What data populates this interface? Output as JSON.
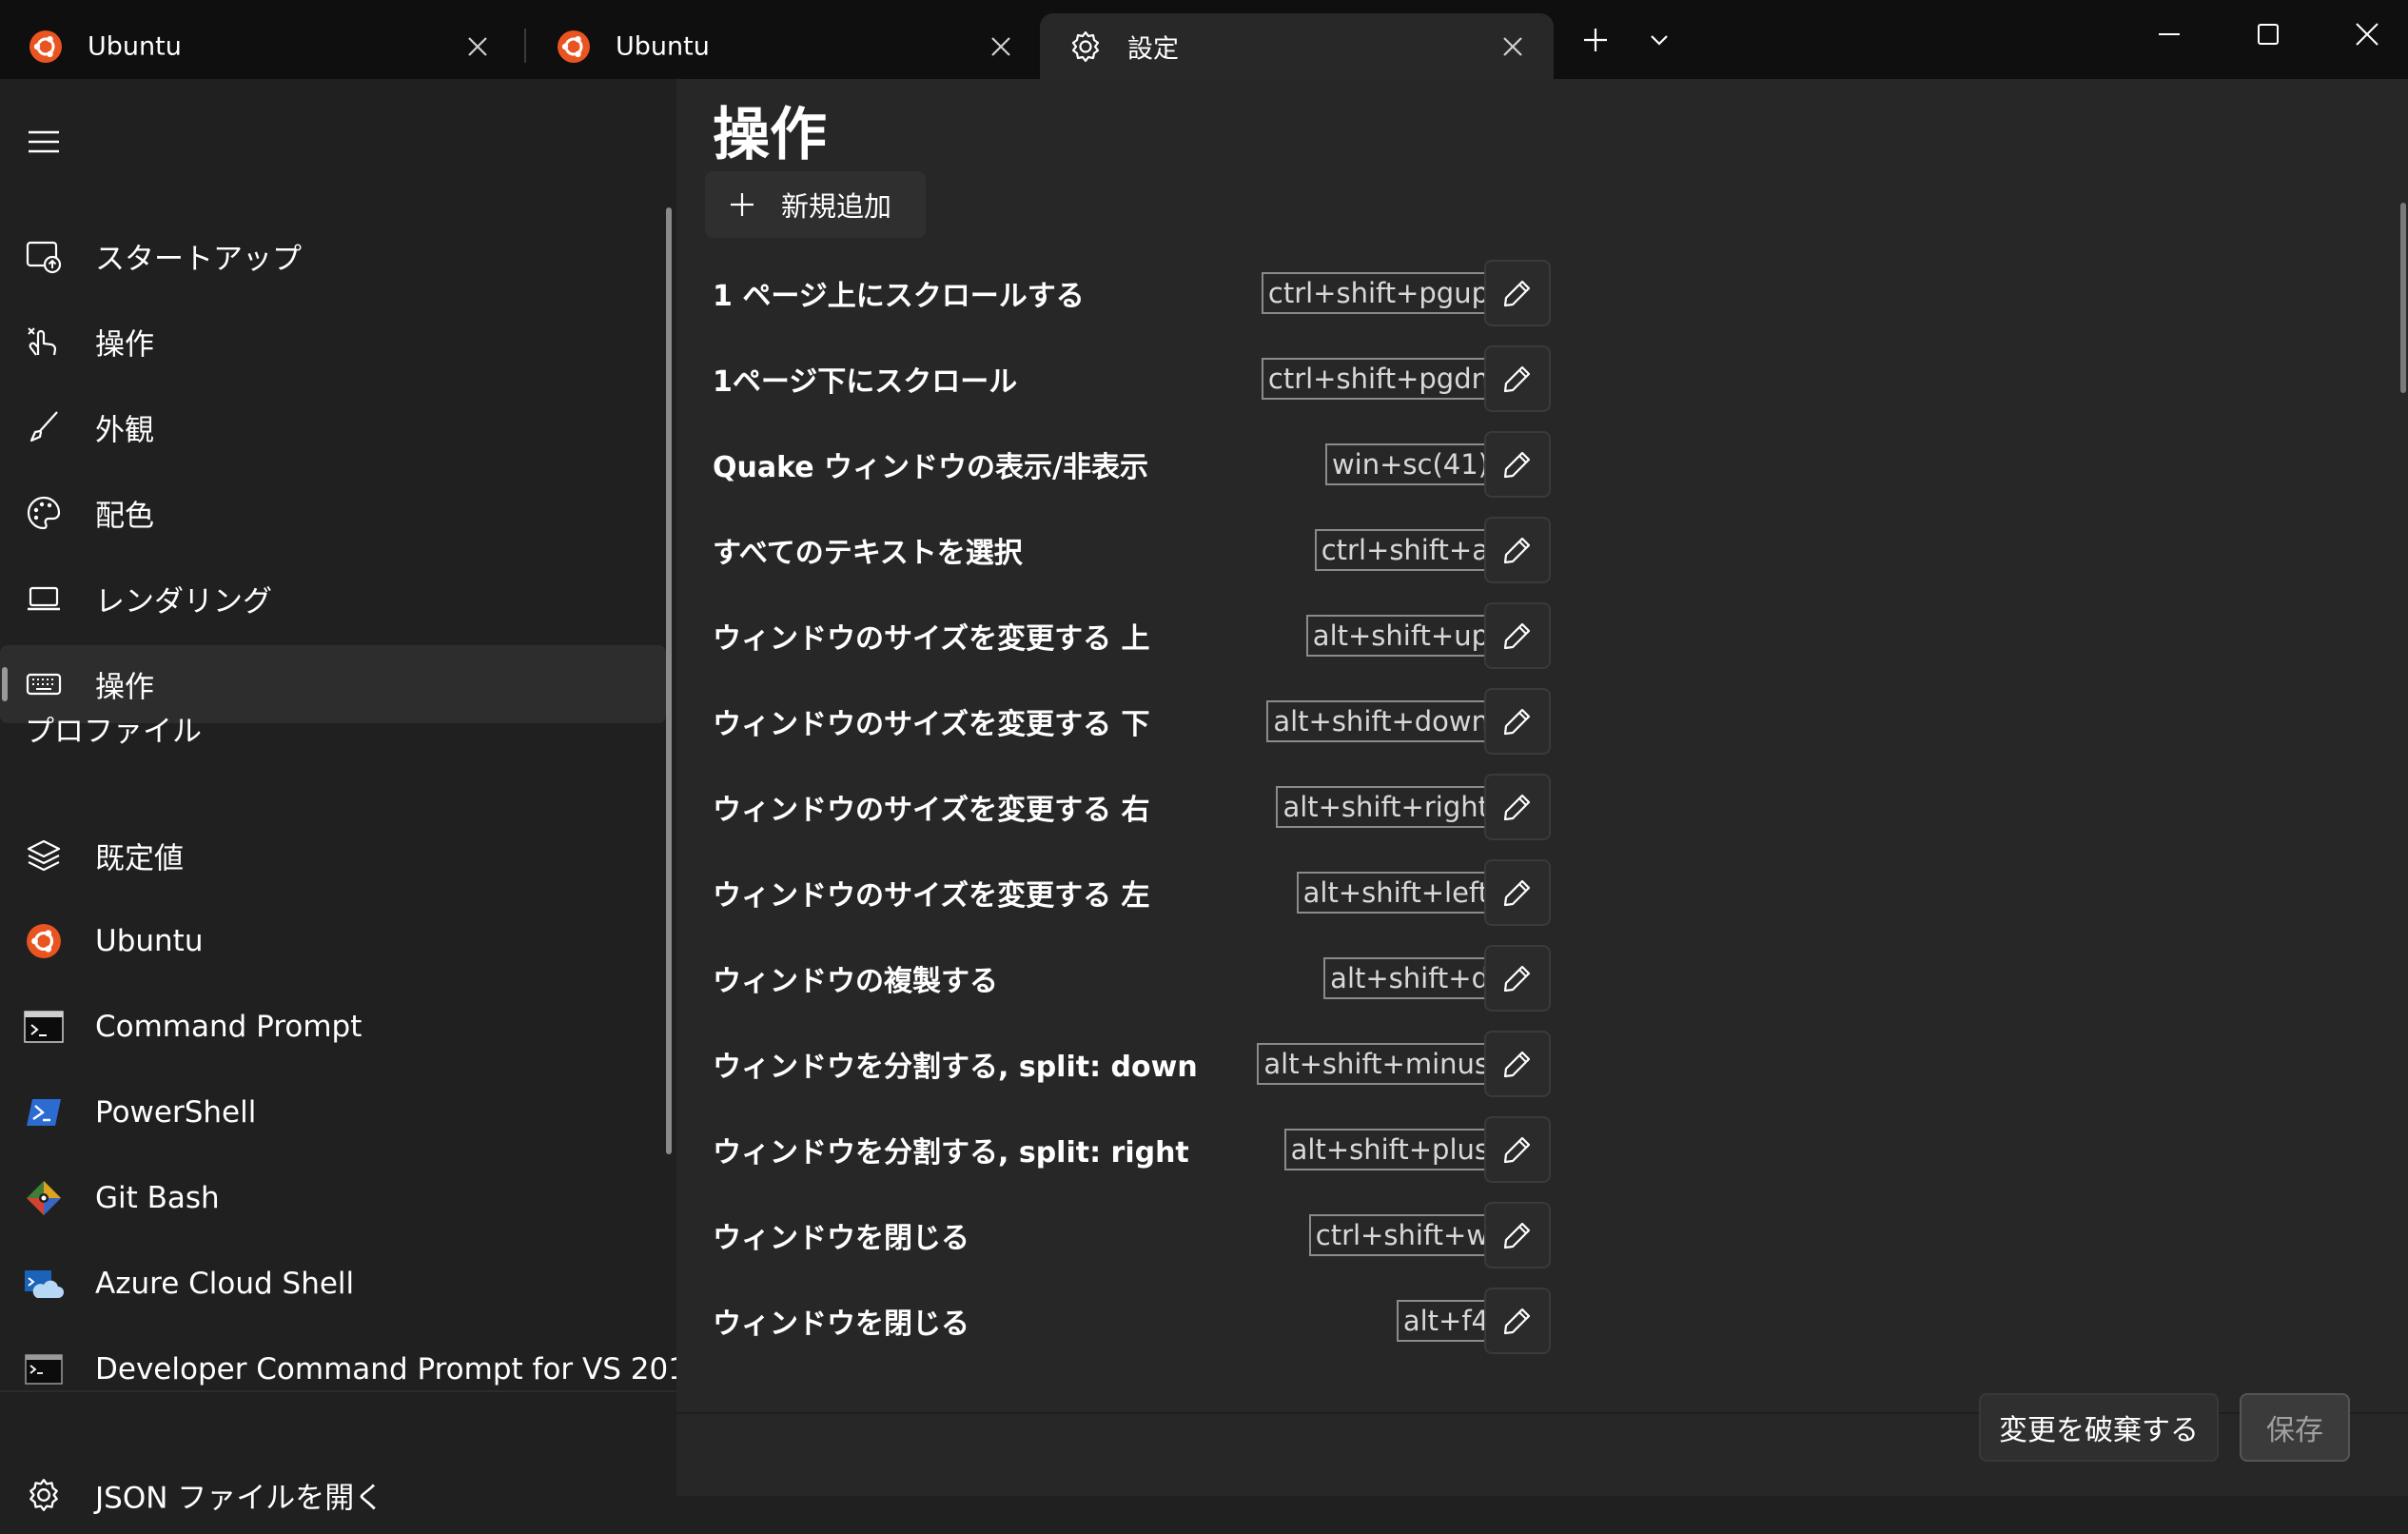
{
  "tabs": [
    {
      "label": "Ubuntu",
      "icon": "ubuntu-icon",
      "active": false
    },
    {
      "label": "Ubuntu",
      "icon": "ubuntu-icon",
      "active": false
    },
    {
      "label": "設定",
      "icon": "gear-icon",
      "active": true
    }
  ],
  "colors": {
    "ubuntu": "#E95420",
    "window_bg": "#202020",
    "content_bg": "#272727"
  },
  "sidebar": {
    "items": [
      {
        "label": "スタートアップ",
        "icon": "startup-icon"
      },
      {
        "label": "操作",
        "icon": "interaction-icon"
      },
      {
        "label": "外観",
        "icon": "brush-icon"
      },
      {
        "label": "配色",
        "icon": "palette-icon"
      },
      {
        "label": "レンダリング",
        "icon": "laptop-icon"
      },
      {
        "label": "操作",
        "icon": "keyboard-icon",
        "selected": true
      }
    ],
    "profiles_header": "プロファイル",
    "profiles": [
      {
        "label": "既定値",
        "icon": "layers-icon"
      },
      {
        "label": "Ubuntu",
        "icon": "ubuntu-icon"
      },
      {
        "label": "Command Prompt",
        "icon": "command-prompt-icon"
      },
      {
        "label": "PowerShell",
        "icon": "powershell-icon"
      },
      {
        "label": "Git Bash",
        "icon": "git-icon"
      },
      {
        "label": "Azure Cloud Shell",
        "icon": "azure-cloud-icon"
      },
      {
        "label": "Developer Command Prompt for VS 201",
        "icon": "dev-prompt-icon"
      }
    ],
    "json_link": {
      "label": "JSON ファイルを開く",
      "icon": "gear-icon"
    }
  },
  "main": {
    "title": "操作",
    "add_button": "新規追加",
    "bindings": [
      {
        "label": "1 ページ上にスクロールする",
        "keys": "ctrl+shift+pgup"
      },
      {
        "label": "1ページ下にスクロール",
        "keys": "ctrl+shift+pgdn"
      },
      {
        "label": "Quake ウィンドウの表示/非表示",
        "keys": "win+sc(41)"
      },
      {
        "label": "すべてのテキストを選択",
        "keys": "ctrl+shift+a"
      },
      {
        "label": "ウィンドウのサイズを変更する 上",
        "keys": "alt+shift+up"
      },
      {
        "label": "ウィンドウのサイズを変更する 下",
        "keys": "alt+shift+down"
      },
      {
        "label": "ウィンドウのサイズを変更する 右",
        "keys": "alt+shift+right"
      },
      {
        "label": "ウィンドウのサイズを変更する 左",
        "keys": "alt+shift+left"
      },
      {
        "label": "ウィンドウの複製する",
        "keys": "alt+shift+d"
      },
      {
        "label": "ウィンドウを分割する, split: down",
        "keys": "alt+shift+minus"
      },
      {
        "label": "ウィンドウを分割する, split: right",
        "keys": "alt+shift+plus"
      },
      {
        "label": "ウィンドウを閉じる",
        "keys": "ctrl+shift+w"
      },
      {
        "label": "ウィンドウを閉じる",
        "keys": "alt+f4"
      }
    ]
  },
  "footer": {
    "discard": "変更を破棄する",
    "save": "保存"
  }
}
